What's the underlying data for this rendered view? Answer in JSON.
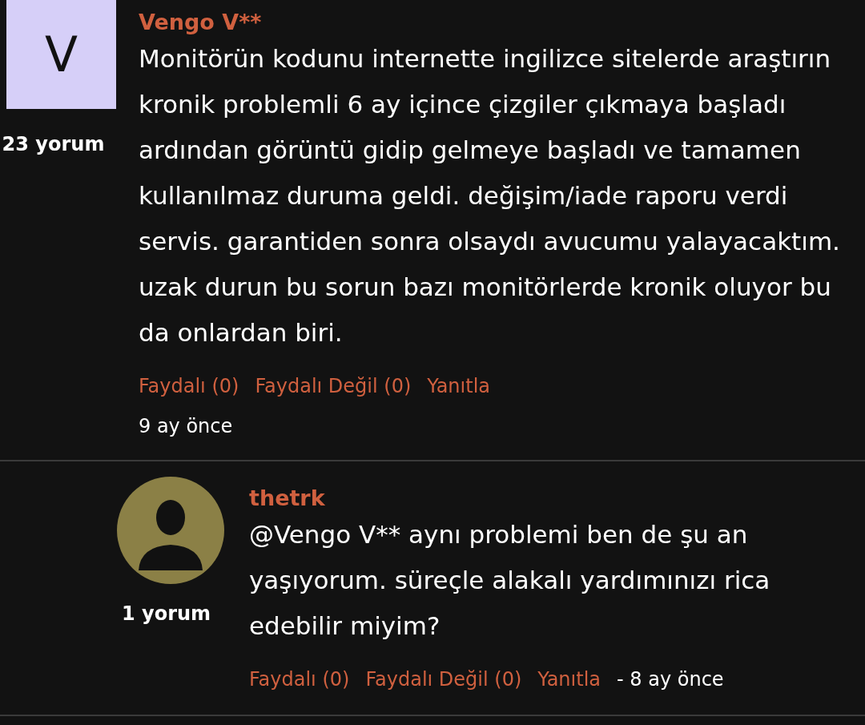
{
  "comments": [
    {
      "avatar_letter": "V",
      "author": "Vengo V**",
      "count": "23 yorum",
      "body": "Monitörün kodunu internette ingilizce sitelerde araştırın kronik problemli 6 ay içince çizgiler çıkmaya başladı ardından görüntü gidip gelmeye başladı ve tamamen kullanılmaz duruma geldi. değişim/iade raporu verdi servis. garantiden sonra olsaydı avucumu yalayacaktım. uzak durun bu sorun bazı monitörlerde kronik oluyor bu da onlardan biri.",
      "actions": [
        "Faydalı (0)",
        "Faydalı Değil (0)",
        "Yanıtla"
      ],
      "time": "9 ay önce",
      "reply": false
    },
    {
      "author": "thetrk",
      "count": "1 yorum",
      "body": "@Vengo V** aynı problemi ben de şu an yaşıyorum. süreçle alakalı yardımınızı rica edebilir miyim?",
      "actions": [
        "Faydalı (0)",
        "Faydalı Değil (0)",
        "Yanıtla"
      ],
      "time": "- 8 ay önce",
      "reply": true
    }
  ]
}
